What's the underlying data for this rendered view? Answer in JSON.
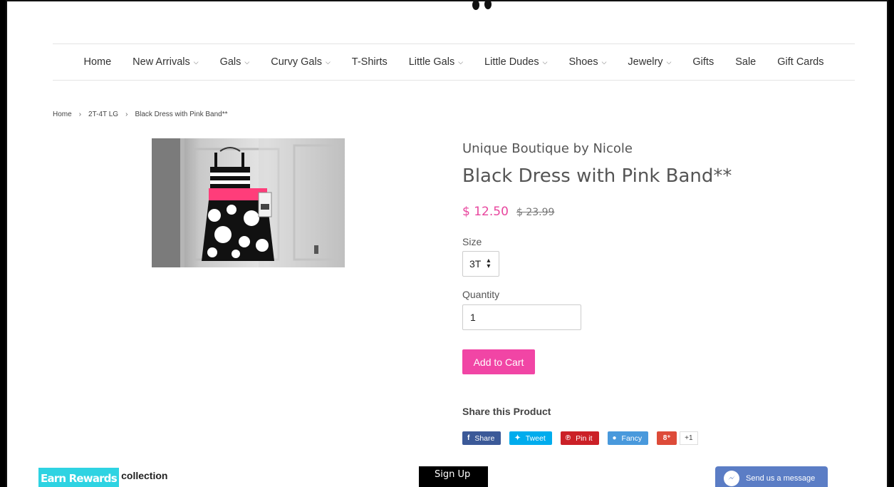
{
  "nav": {
    "items": [
      {
        "label": "Home",
        "dropdown": false
      },
      {
        "label": "New Arrivals",
        "dropdown": true
      },
      {
        "label": "Gals",
        "dropdown": true
      },
      {
        "label": "Curvy Gals",
        "dropdown": true
      },
      {
        "label": "T-Shirts",
        "dropdown": false
      },
      {
        "label": "Little Gals",
        "dropdown": true
      },
      {
        "label": "Little Dudes",
        "dropdown": true
      },
      {
        "label": "Shoes",
        "dropdown": true
      },
      {
        "label": "Jewelry",
        "dropdown": true
      },
      {
        "label": "Gifts",
        "dropdown": false
      },
      {
        "label": "Sale",
        "dropdown": false
      },
      {
        "label": "Gift Cards",
        "dropdown": false
      }
    ],
    "caret": "⌵"
  },
  "breadcrumb": {
    "items": [
      "Home",
      "2T-4T LG",
      "Black Dress with Pink Band**"
    ],
    "separator": "›"
  },
  "product": {
    "vendor": "Unique Boutique by Nicole",
    "title": "Black Dress with Pink Band**",
    "sale_price": "$ 12.50",
    "compare_price": "$ 23.99",
    "size_label": "Size",
    "size_value": "3T",
    "quantity_label": "Quantity",
    "quantity_value": "1",
    "add_to_cart": "Add to Cart"
  },
  "share": {
    "title": "Share this Product",
    "buttons": [
      {
        "label": "Share",
        "icon": "facebook-icon",
        "glyph": "f"
      },
      {
        "label": "Tweet",
        "icon": "twitter-icon",
        "glyph": "✦"
      },
      {
        "label": "Pin it",
        "icon": "pinterest-icon",
        "glyph": "℗"
      },
      {
        "label": "Fancy",
        "icon": "fancy-icon",
        "glyph": "●"
      }
    ],
    "gplus_glyph": "8⁺",
    "gplus_count": "+1"
  },
  "footer": {
    "collection_heading_visible": "his collection",
    "rewards": "Earn Rewards",
    "signup": "Sign Up",
    "messenger": "Send us a message"
  },
  "colors": {
    "accent": "#f145a5",
    "sale_price": "#e8469e",
    "facebook": "#3b5998",
    "twitter": "#00aced",
    "pinterest": "#cb2027",
    "fancy": "#4999dc",
    "gplus": "#dd4b39",
    "rewards": "#2ed3e2",
    "messenger": "#5b7dc5"
  }
}
